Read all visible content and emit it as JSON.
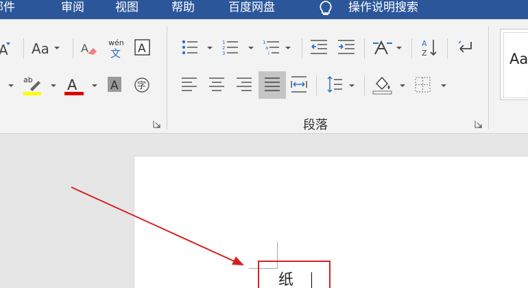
{
  "menu": {
    "items": [
      "邮件",
      "审阅",
      "视图",
      "帮助",
      "百度网盘"
    ],
    "tell_me": "操作说明搜索"
  },
  "ribbon": {
    "font_group": {
      "font_size_label": "A",
      "change_case_label": "Aa",
      "wen_label": "wén",
      "wen_char": "文",
      "border_char": "A",
      "font_color_char": "A",
      "shading_char": "A",
      "enclose_char": "字",
      "highlight_label": "ab",
      "highlight_color": "#ffff00",
      "font_color": "#e00000"
    },
    "paragraph_group": {
      "label": "段落"
    },
    "styles": {
      "sample": "Aa",
      "mark": "↵"
    }
  },
  "document": {
    "text": "纸"
  },
  "colors": {
    "ribbon_blue": "#2b579a",
    "annotation_red": "#d61f1f"
  }
}
